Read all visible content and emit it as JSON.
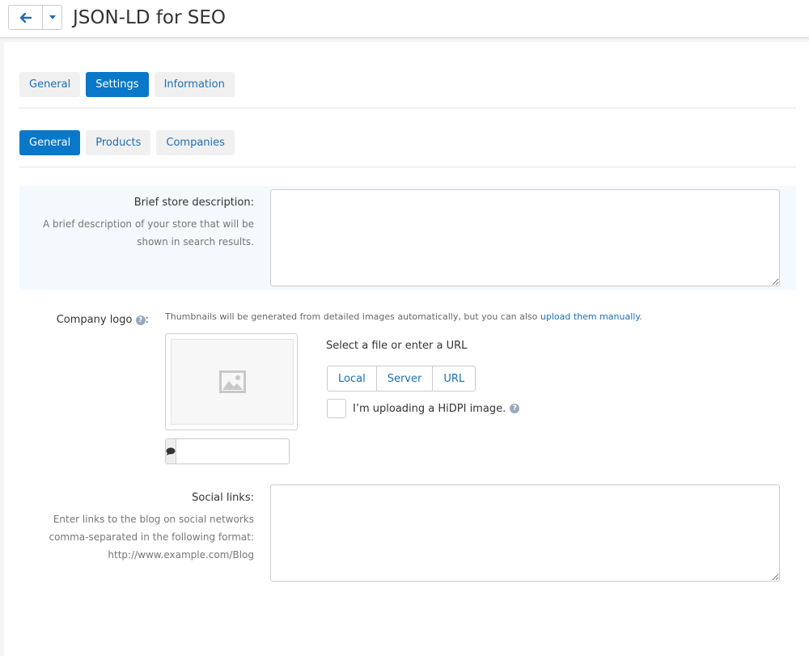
{
  "header": {
    "title": "JSON-LD for SEO"
  },
  "main_tabs": [
    {
      "label": "General",
      "active": false
    },
    {
      "label": "Settings",
      "active": true
    },
    {
      "label": "Information",
      "active": false
    }
  ],
  "sub_tabs": [
    {
      "label": "General",
      "active": true
    },
    {
      "label": "Products",
      "active": false
    },
    {
      "label": "Companies",
      "active": false
    }
  ],
  "brief_description": {
    "label": "Brief store description:",
    "help": "A brief description of your store that will be shown in search results.",
    "value": ""
  },
  "company_logo": {
    "label": "Company logo",
    "label_suffix": ":",
    "hint_text": "Thumbnails will be generated from detailed images automatically, but you can also ",
    "hint_link": "upload them manually",
    "hint_end": ".",
    "upload_title": "Select a file or enter a URL",
    "upload_buttons": [
      "Local",
      "Server",
      "URL"
    ],
    "hidpi_label": "I’m uploading a HiDPI image.",
    "alt_text_value": ""
  },
  "social_links": {
    "label": "Social links:",
    "help": "Enter links to the blog on social networks comma-separated in the following format: http://www.example.com/Blog",
    "value": ""
  },
  "colors": {
    "accent": "#0a78c8",
    "link": "#1a6fb4",
    "highlight_row": "#f3f9fc"
  },
  "icons": [
    "arrow-left-icon",
    "caret-down-icon",
    "help-icon",
    "image-placeholder-icon",
    "comment-icon"
  ]
}
